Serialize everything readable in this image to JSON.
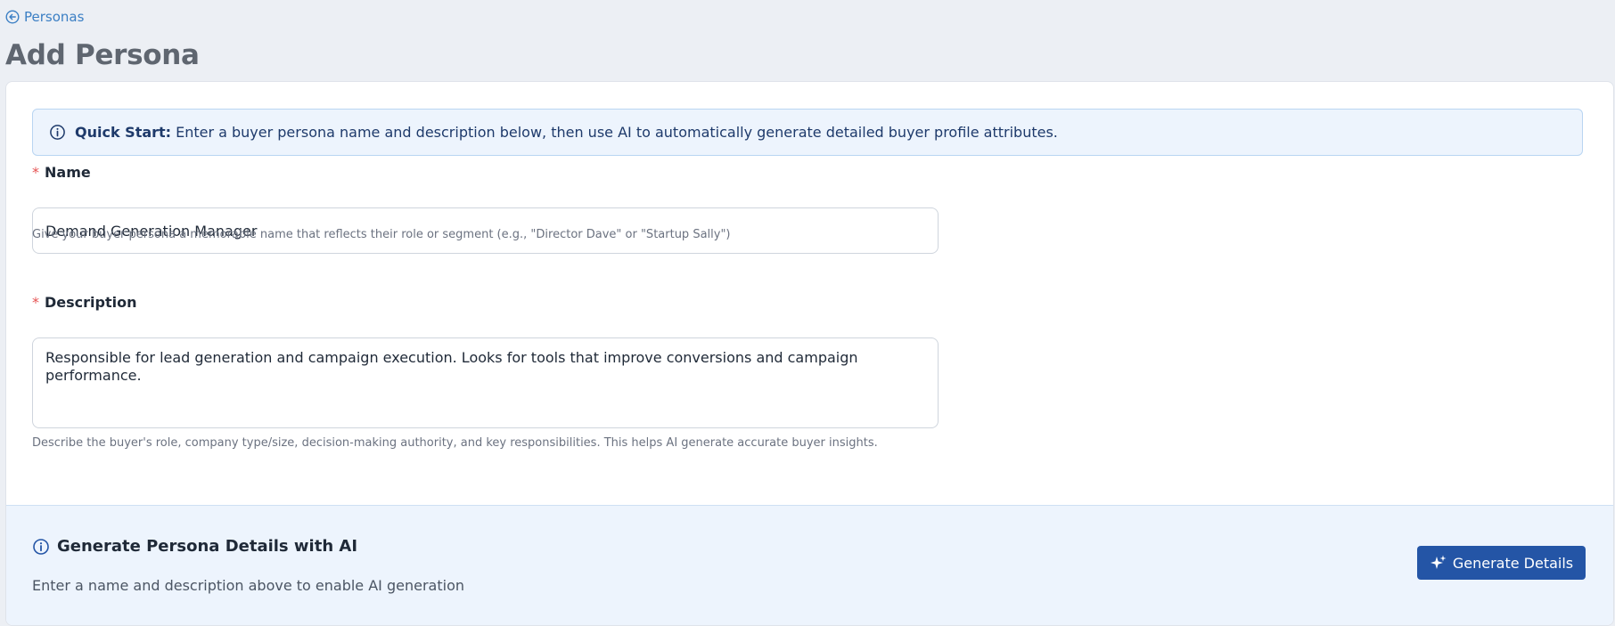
{
  "breadcrumb": {
    "label": "Personas",
    "icon": "arrow-left-circle-icon",
    "color": "#3b7fc4"
  },
  "page": {
    "title": "Add Persona"
  },
  "alert": {
    "icon": "info-icon",
    "strong": "Quick Start:",
    "text": "Enter a buyer persona name and description below, then use AI to automatically generate detailed buyer profile attributes."
  },
  "fields": {
    "name": {
      "required_mark": "*",
      "label": "Name",
      "value": "Demand Generation Manager",
      "help": "Give your buyer persona a memorable name that reflects their role or segment (e.g., \"Director Dave\" or \"Startup Sally\")"
    },
    "description": {
      "required_mark": "*",
      "label": "Description",
      "value": "Responsible for lead generation and campaign execution. Looks for tools that improve conversions and campaign performance.",
      "help": "Describe the buyer's role, company type/size, decision-making authority, and key responsibilities. This helps AI generate accurate buyer insights."
    }
  },
  "ai": {
    "icon": "info-icon",
    "title": "Generate Persona Details with AI",
    "subtitle": "Enter a name and description above to enable AI generation",
    "button_icon": "sparkles-icon",
    "button_label": "Generate Details",
    "button_color": "#2455a6"
  }
}
